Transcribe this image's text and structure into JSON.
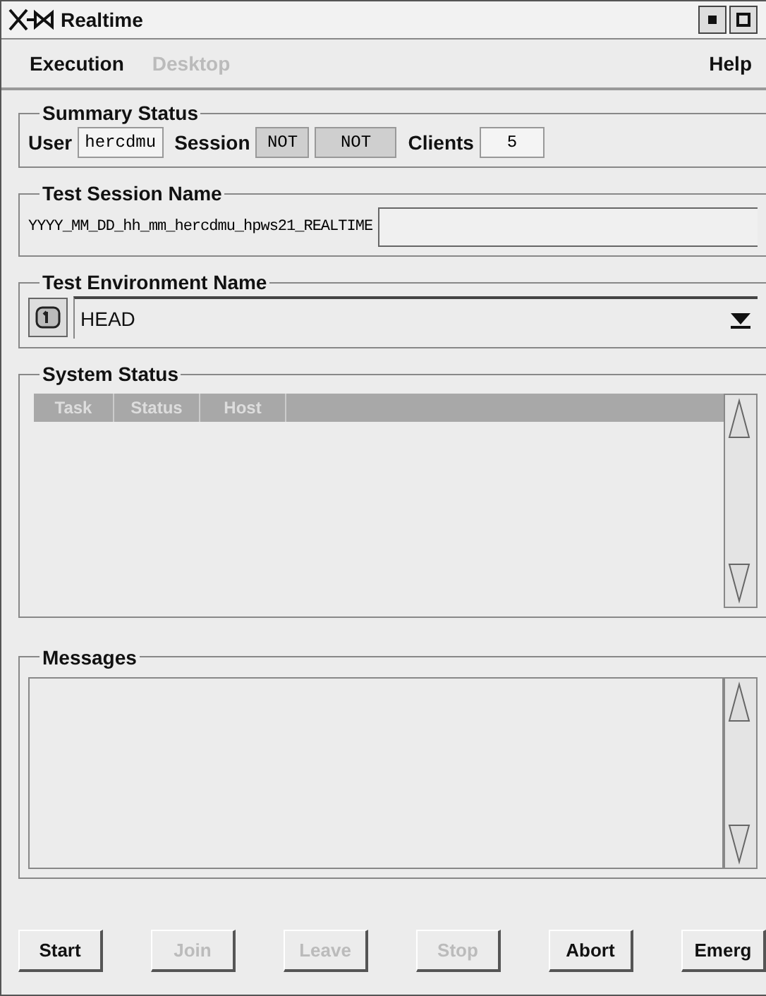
{
  "window": {
    "title": "Realtime"
  },
  "menu": [
    {
      "label": "Execution",
      "disabled": false
    },
    {
      "label": "Desktop",
      "disabled": true
    }
  ],
  "help_menu": {
    "label": "Help",
    "disabled": false
  },
  "summary_status": {
    "title": "Summary Status",
    "user_label": "User",
    "user": "hercdmu",
    "session_label": "Session",
    "session": [
      "NOT",
      "NOT"
    ],
    "clients_label": "Clients",
    "clients": "5"
  },
  "test_session": {
    "title": "Test Session Name",
    "name": "YYYY_MM_DD_hh_mm_hercdmu_hpws21_REALTIME"
  },
  "test_environment": {
    "title": "Test Environment Name",
    "value": "HEAD"
  },
  "system_status": {
    "title": "System Status",
    "columns": [
      "Task",
      "Status",
      "Host"
    ]
  },
  "messages": {
    "title": "Messages"
  },
  "buttons": [
    {
      "label": "Start",
      "disabled": false
    },
    {
      "label": "Join",
      "disabled": true
    },
    {
      "label": "Leave",
      "disabled": true
    },
    {
      "label": "Stop",
      "disabled": true
    },
    {
      "label": "Abort",
      "disabled": false
    },
    {
      "label": "Emerg",
      "disabled": false
    }
  ]
}
